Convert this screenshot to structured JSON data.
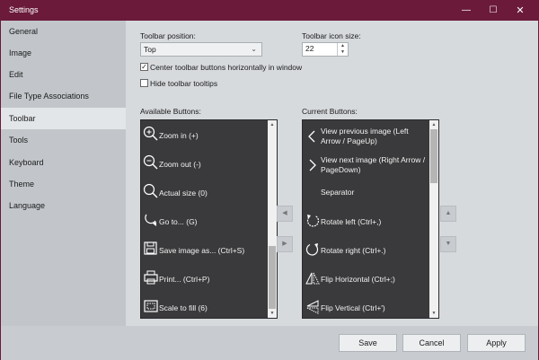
{
  "window": {
    "title": "Settings",
    "minimize_glyph": "—",
    "maximize_glyph": "☐",
    "close_glyph": "✕"
  },
  "sidebar": {
    "items": [
      {
        "label": "General",
        "active": false
      },
      {
        "label": "Image",
        "active": false
      },
      {
        "label": "Edit",
        "active": false
      },
      {
        "label": "File Type Associations",
        "active": false
      },
      {
        "label": "Toolbar",
        "active": true
      },
      {
        "label": "Tools",
        "active": false
      },
      {
        "label": "Keyboard",
        "active": false
      },
      {
        "label": "Theme",
        "active": false
      },
      {
        "label": "Language",
        "active": false
      }
    ]
  },
  "toolbar_settings": {
    "position_label": "Toolbar position:",
    "position_value": "Top",
    "icon_size_label": "Toolbar icon size:",
    "icon_size_value": "22",
    "center_buttons_label": "Center toolbar buttons horizontally in window",
    "center_buttons_checked": true,
    "hide_tooltips_label": "Hide toolbar tooltips",
    "hide_tooltips_checked": false
  },
  "available": {
    "label": "Available Buttons:",
    "items": [
      {
        "icon": "zoom-in-icon",
        "label": "Zoom in (+)"
      },
      {
        "icon": "zoom-out-icon",
        "label": "Zoom out (-)"
      },
      {
        "icon": "actual-size-icon",
        "label": "Actual size (0)"
      },
      {
        "icon": "go-to-icon",
        "label": "Go to... (G)"
      },
      {
        "icon": "save-as-icon",
        "label": "Save image as... (Ctrl+S)"
      },
      {
        "icon": "print-icon",
        "label": "Print... (Ctrl+P)"
      },
      {
        "icon": "scale-to-fill-icon",
        "label": "Scale to fill (6)"
      }
    ]
  },
  "current": {
    "label": "Current Buttons:",
    "items": [
      {
        "icon": "chevron-left-icon",
        "label": "View previous image (Left Arrow / PageUp)"
      },
      {
        "icon": "chevron-right-icon",
        "label": "View next image (Right Arrow / PageDown)"
      },
      {
        "icon": "",
        "label": "Separator"
      },
      {
        "icon": "rotate-left-icon",
        "label": "Rotate left (Ctrl+,)"
      },
      {
        "icon": "rotate-right-icon",
        "label": "Rotate right (Ctrl+.)"
      },
      {
        "icon": "flip-horizontal-icon",
        "label": "Flip Horizontal (Ctrl+;)"
      },
      {
        "icon": "flip-vertical-icon",
        "label": "Flip Vertical (Ctrl+')"
      }
    ]
  },
  "move_buttons": {
    "add_glyph": "◀",
    "remove_glyph": "▶",
    "up_glyph": "▲",
    "down_glyph": "▼"
  },
  "footer": {
    "save": "Save",
    "cancel": "Cancel",
    "apply": "Apply"
  },
  "colors": {
    "titlebar": "#6b1a3a",
    "list_bg": "#3a3a3c",
    "active_nav": "#e3e6e8"
  }
}
